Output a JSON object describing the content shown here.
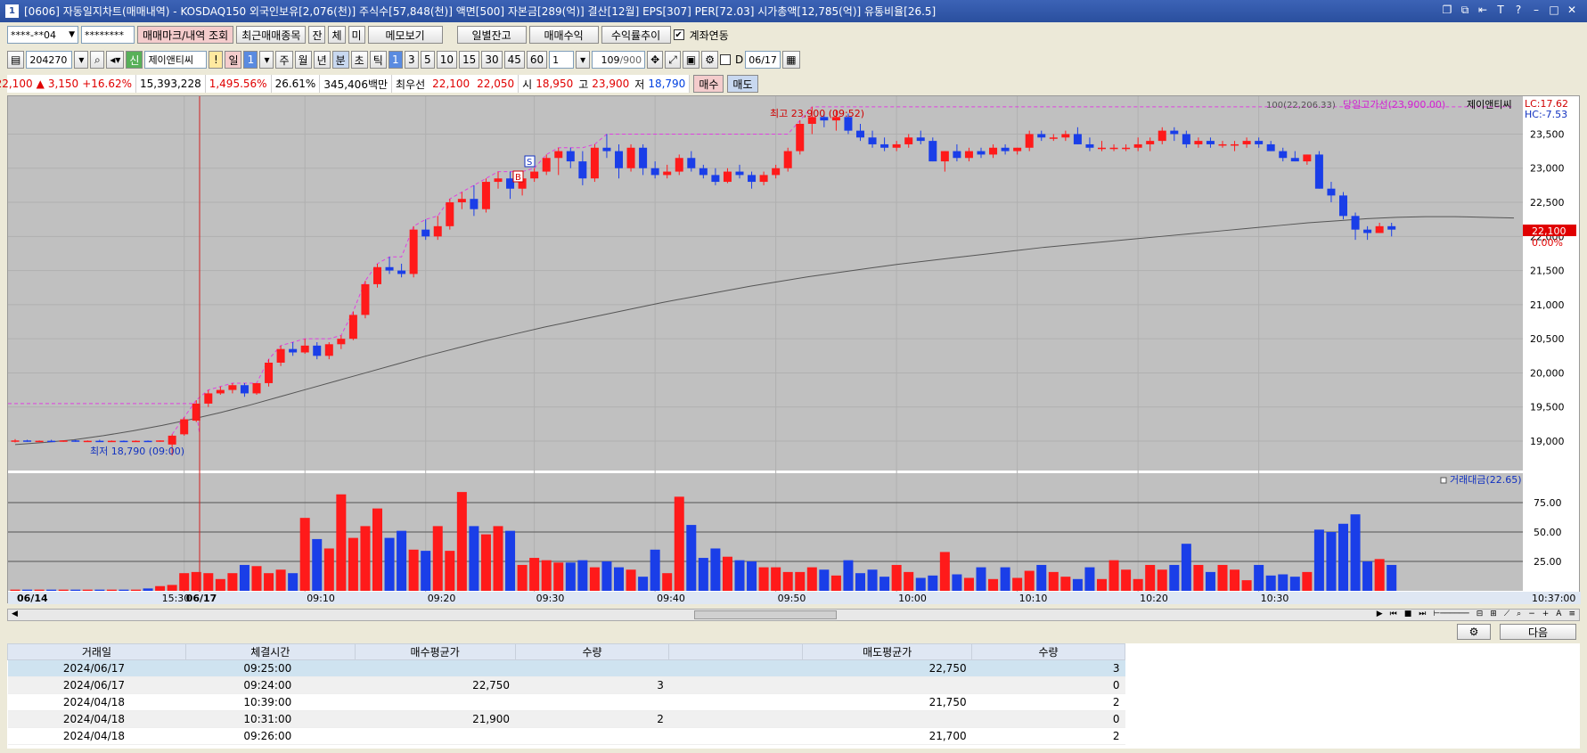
{
  "window": {
    "title": "[0606] 자동일지차트(매매내역) - KOSDAQ150 외국인보유[2,076(천)] 주식수[57,848(천)] 액면[500] 자본금[289(억)] 결산[12월] EPS[307] PER[72.03] 시가총액[12,785(억)] 유통비율[26.5]",
    "app_icon": "1"
  },
  "toolbar1": {
    "account": "****-**04",
    "password": "********",
    "trade_mark_btn": "매매마크/내역 조회",
    "recent_btn": "최근매매종목",
    "tab_jan": "잔",
    "tab_che": "체",
    "tab_mi": "미",
    "memo_btn": "메모보기",
    "daily_balance_btn": "일별잔고",
    "trade_profit_btn": "매매수익",
    "profit_trend_btn": "수익률추이",
    "account_link_label": "계좌연동"
  },
  "toolbar2": {
    "code": "204270",
    "credit_badge": "신",
    "stock_name": "제이앤티씨",
    "alert": "!",
    "period_day": "일",
    "period_num": "1",
    "period_week": "주",
    "period_month": "월",
    "period_year": "년",
    "period_min": "분",
    "period_sec": "초",
    "period_tick": "틱",
    "intervals": [
      "1",
      "3",
      "5",
      "10",
      "15",
      "30",
      "45",
      "60"
    ],
    "interval_count": "1",
    "count": "109",
    "count_max": "/900",
    "date_check": "D",
    "date": "06/17"
  },
  "quote": {
    "price": "22,100",
    "arrow": "▲",
    "change": "3,150",
    "change_pct": "+16.62%",
    "volume": "15,393,228",
    "vol_ratio": "1,495.56%",
    "turnover": "26.61%",
    "amount": "345,406백만",
    "best_label": "최우선",
    "ask": "22,100",
    "bid": "22,050",
    "open_label": "시",
    "open": "18,950",
    "high_label": "고",
    "high": "23,900",
    "low_label": "저",
    "low": "18,790",
    "buy_btn": "매수",
    "sell_btn": "매도"
  },
  "chart": {
    "ma_label": "100(22,206.33)",
    "day_high_label": "당일고가선(23,900.00)",
    "name_label": "제이앤티씨",
    "lc_label": "LC:17.62",
    "hc_label": "HC:-7.53",
    "high_marker": "최고 23,900 (09:52)",
    "low_marker": "최저 18,790 (09:00)",
    "current_price_tag": "22,100",
    "current_pct_tag": "0.00%",
    "buy_mark": "B",
    "sell_mark": "S",
    "price_ticks": [
      "23,500",
      "23,000",
      "22,500",
      "22,000",
      "21,500",
      "21,000",
      "20,500",
      "20,000",
      "19,500",
      "19,000"
    ],
    "volume_label": "거래대금(22.65)",
    "vol_ticks": [
      "75.00",
      "50.00",
      "25.00"
    ],
    "time_labels": [
      "06/14",
      "15:30",
      "06/17",
      "09:10",
      "09:20",
      "09:30",
      "09:40",
      "09:50",
      "10:00",
      "10:10",
      "10:20",
      "10:30",
      "10:37:00"
    ],
    "colors": {
      "up": "#ff1a1a",
      "down": "#1a3ee8",
      "bg": "#c0c0c0",
      "highline": "#e040e0",
      "ma": "#555555"
    }
  },
  "chart_data": {
    "type": "candlestick",
    "title": "",
    "interval": "1분",
    "prev_close": 18950,
    "day_high": 23900,
    "candles": [
      [
        19000,
        19030,
        18980,
        19010
      ],
      [
        19010,
        19020,
        18990,
        19000
      ],
      [
        19000,
        19010,
        18990,
        19005
      ],
      [
        19005,
        19020,
        18990,
        19000
      ],
      [
        19000,
        19010,
        18990,
        19010
      ],
      [
        19010,
        19020,
        18990,
        19000
      ],
      [
        19000,
        19010,
        18990,
        19005
      ],
      [
        19005,
        19020,
        18990,
        19000
      ],
      [
        19000,
        19010,
        18990,
        19005
      ],
      [
        19005,
        19010,
        18990,
        19000
      ],
      [
        19000,
        19010,
        18990,
        19005
      ],
      [
        19005,
        19010,
        18990,
        19000
      ],
      [
        19000,
        19010,
        18990,
        19010
      ],
      [
        18950,
        19100,
        18790,
        19080
      ],
      [
        19100,
        19350,
        19080,
        19320
      ],
      [
        19300,
        19600,
        19280,
        19550
      ],
      [
        19550,
        19750,
        19500,
        19700
      ],
      [
        19700,
        19800,
        19680,
        19750
      ],
      [
        19750,
        19850,
        19700,
        19820
      ],
      [
        19820,
        19850,
        19650,
        19700
      ],
      [
        19700,
        19850,
        19680,
        19850
      ],
      [
        19850,
        20200,
        19800,
        20150
      ],
      [
        20150,
        20400,
        20100,
        20350
      ],
      [
        20350,
        20450,
        20250,
        20300
      ],
      [
        20300,
        20500,
        20280,
        20400
      ],
      [
        20400,
        20450,
        20200,
        20250
      ],
      [
        20250,
        20450,
        20200,
        20420
      ],
      [
        20420,
        20550,
        20350,
        20500
      ],
      [
        20500,
        20900,
        20480,
        20850
      ],
      [
        20850,
        21350,
        20800,
        21300
      ],
      [
        21300,
        21600,
        21250,
        21550
      ],
      [
        21550,
        21700,
        21450,
        21500
      ],
      [
        21500,
        21600,
        21400,
        21450
      ],
      [
        21450,
        22150,
        21400,
        22100
      ],
      [
        22100,
        22250,
        21950,
        22000
      ],
      [
        22000,
        22300,
        21950,
        22150
      ],
      [
        22150,
        22550,
        22100,
        22500
      ],
      [
        22500,
        22650,
        22400,
        22550
      ],
      [
        22550,
        22750,
        22300,
        22400
      ],
      [
        22400,
        22850,
        22350,
        22800
      ],
      [
        22800,
        22950,
        22700,
        22850
      ],
      [
        22850,
        22950,
        22550,
        22700
      ],
      [
        22700,
        22950,
        22600,
        22850
      ],
      [
        22850,
        23000,
        22800,
        22950
      ],
      [
        22950,
        23200,
        22900,
        23150
      ],
      [
        23150,
        23300,
        22900,
        23250
      ],
      [
        23250,
        23300,
        23000,
        23100
      ],
      [
        23100,
        23250,
        22750,
        22850
      ],
      [
        22850,
        23350,
        22800,
        23300
      ],
      [
        23300,
        23500,
        23150,
        23250
      ],
      [
        23250,
        23350,
        22850,
        23000
      ],
      [
        23000,
        23350,
        22950,
        23300
      ],
      [
        23300,
        23350,
        22900,
        23000
      ],
      [
        23000,
        23100,
        22850,
        22900
      ],
      [
        22900,
        23050,
        22850,
        22950
      ],
      [
        22950,
        23200,
        22900,
        23150
      ],
      [
        23150,
        23250,
        22950,
        23000
      ],
      [
        23000,
        23050,
        22850,
        22900
      ],
      [
        22900,
        23000,
        22750,
        22800
      ],
      [
        22800,
        23000,
        22780,
        22950
      ],
      [
        22950,
        23050,
        22850,
        22900
      ],
      [
        22900,
        22950,
        22700,
        22800
      ],
      [
        22800,
        22950,
        22750,
        22900
      ],
      [
        22900,
        23050,
        22850,
        23000
      ],
      [
        23000,
        23300,
        22950,
        23250
      ],
      [
        23250,
        23700,
        23200,
        23650
      ],
      [
        23650,
        23900,
        23500,
        23750
      ],
      [
        23750,
        23800,
        23600,
        23700
      ],
      [
        23700,
        23850,
        23550,
        23750
      ],
      [
        23750,
        23800,
        23500,
        23550
      ],
      [
        23550,
        23650,
        23400,
        23450
      ],
      [
        23450,
        23550,
        23300,
        23350
      ],
      [
        23350,
        23450,
        23250,
        23300
      ],
      [
        23300,
        23400,
        23250,
        23350
      ],
      [
        23350,
        23500,
        23300,
        23450
      ],
      [
        23450,
        23550,
        23350,
        23400
      ],
      [
        23400,
        23450,
        23100,
        23100
      ],
      [
        23100,
        23250,
        22950,
        23250
      ],
      [
        23250,
        23350,
        23100,
        23150
      ],
      [
        23150,
        23300,
        23100,
        23250
      ],
      [
        23250,
        23300,
        23150,
        23200
      ],
      [
        23200,
        23350,
        23150,
        23300
      ],
      [
        23300,
        23350,
        23200,
        23250
      ],
      [
        23250,
        23300,
        23200,
        23300
      ],
      [
        23300,
        23550,
        23250,
        23500
      ],
      [
        23500,
        23550,
        23400,
        23450
      ],
      [
        23450,
        23500,
        23400,
        23450
      ],
      [
        23450,
        23550,
        23400,
        23500
      ],
      [
        23500,
        23600,
        23350,
        23350
      ],
      [
        23350,
        23450,
        23250,
        23300
      ],
      [
        23300,
        23400,
        23250,
        23300
      ],
      [
        23300,
        23350,
        23250,
        23300
      ],
      [
        23300,
        23350,
        23250,
        23300
      ],
      [
        23300,
        23450,
        23250,
        23350
      ],
      [
        23350,
        23450,
        23250,
        23400
      ],
      [
        23400,
        23600,
        23350,
        23550
      ],
      [
        23550,
        23600,
        23400,
        23500
      ],
      [
        23500,
        23550,
        23300,
        23350
      ],
      [
        23350,
        23450,
        23300,
        23400
      ],
      [
        23400,
        23450,
        23300,
        23350
      ],
      [
        23350,
        23400,
        23300,
        23350
      ],
      [
        23350,
        23400,
        23250,
        23350
      ],
      [
        23350,
        23450,
        23300,
        23400
      ],
      [
        23400,
        23450,
        23300,
        23350
      ],
      [
        23350,
        23400,
        23250,
        23250
      ],
      [
        23250,
        23300,
        23100,
        23150
      ],
      [
        23150,
        23250,
        23100,
        23100
      ],
      [
        23100,
        23200,
        23050,
        23200
      ],
      [
        23200,
        23250,
        22700,
        22700
      ],
      [
        22700,
        22800,
        22500,
        22600
      ],
      [
        22600,
        22650,
        22250,
        22300
      ],
      [
        22300,
        22350,
        21950,
        22100
      ],
      [
        22100,
        22150,
        21950,
        22050
      ],
      [
        22050,
        22200,
        22050,
        22150
      ],
      [
        22150,
        22200,
        22000,
        22100
      ]
    ],
    "ma100": [
      18950,
      18980,
      19020,
      19080,
      19150,
      19230,
      19320,
      19420,
      19530,
      19650,
      19770,
      19890,
      20010,
      20130,
      20250,
      20360,
      20470,
      20570,
      20670,
      20760,
      20850,
      20940,
      21030,
      21110,
      21190,
      21270,
      21340,
      21410,
      21470,
      21530,
      21590,
      21640,
      21690,
      21740,
      21790,
      21840,
      21880,
      21920,
      21960,
      22000,
      22040,
      22080,
      22120,
      22160,
      22200,
      22230,
      22260,
      22280,
      22290,
      22290,
      22280,
      22270
    ],
    "turnover": [
      1,
      1,
      1,
      1,
      1,
      1,
      1,
      1,
      1,
      1,
      1,
      2,
      4,
      5,
      15,
      16,
      15,
      10,
      15,
      22,
      21,
      15,
      18,
      15,
      62,
      44,
      36,
      82,
      45,
      55,
      70,
      45,
      51,
      35,
      34,
      55,
      34,
      84,
      55,
      48,
      55,
      51,
      22,
      28,
      26,
      24,
      24,
      26,
      20,
      25,
      20,
      18,
      12,
      35,
      15,
      80,
      56,
      28,
      36,
      29,
      26,
      25,
      20,
      20,
      16,
      16,
      20,
      18,
      13,
      26,
      15,
      18,
      12,
      22,
      16,
      11,
      13,
      33,
      14,
      11,
      20,
      10,
      20,
      11,
      17,
      22,
      16,
      12,
      10,
      20,
      10,
      26,
      18,
      10,
      22,
      18,
      22,
      40,
      22,
      16,
      22,
      18,
      9,
      22,
      13,
      14,
      12,
      16,
      52,
      50,
      57,
      65,
      25,
      27,
      22
    ]
  },
  "grid_buttons": {
    "settings": "⚙",
    "next": "다음"
  },
  "trade_table": {
    "headers": [
      "거래일",
      "체결시간",
      "매수평균가",
      "수량",
      "",
      "매도평균가",
      "수량"
    ],
    "rows": [
      [
        "2024/06/17",
        "09:25:00",
        "",
        "",
        "",
        "22,750",
        "3"
      ],
      [
        "2024/06/17",
        "09:24:00",
        "22,750",
        "3",
        "",
        "",
        "0"
      ],
      [
        "2024/04/18",
        "10:39:00",
        "",
        "",
        "",
        "21,750",
        "2"
      ],
      [
        "2024/04/18",
        "10:31:00",
        "21,900",
        "2",
        "",
        "",
        "0"
      ],
      [
        "2024/04/18",
        "09:26:00",
        "",
        "",
        "",
        "21,700",
        "2"
      ]
    ]
  }
}
